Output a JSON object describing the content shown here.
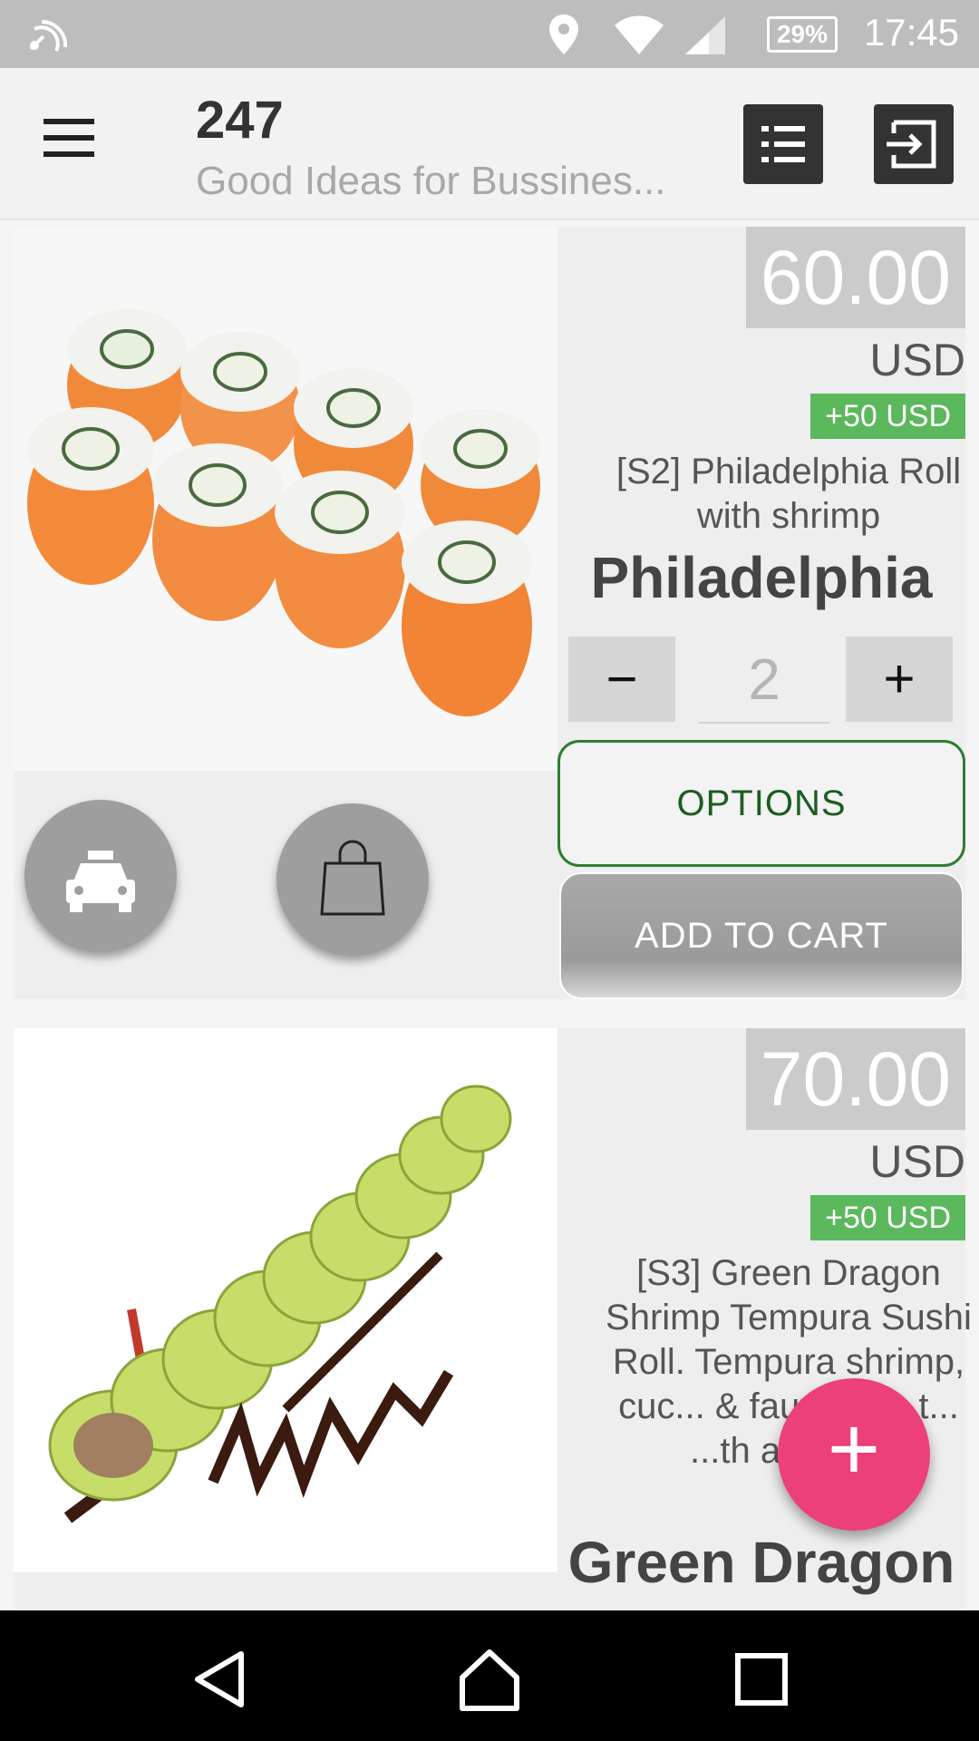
{
  "status_bar": {
    "time": "17:45",
    "battery": "29%",
    "icons": [
      "nfc-icon",
      "location-icon",
      "wifi-icon",
      "signal-icon",
      "battery-icon"
    ]
  },
  "app_bar": {
    "title": "247",
    "subtitle": "Good Ideas for Bussines...",
    "icons": [
      "menu-icon",
      "list-icon",
      "logout-icon"
    ]
  },
  "products": [
    {
      "price": "60.00",
      "currency": "USD",
      "extra": "+50 USD",
      "description": "[S2] Philadelphia Roll with shrimp",
      "name": "Philadelphia",
      "quantity": "2",
      "minus_label": "−",
      "plus_label": "+",
      "options_label": "OPTIONS",
      "add_to_cart_label": "ADD TO CART",
      "action_icons": [
        "taxi-icon",
        "shopping-bag-icon"
      ]
    },
    {
      "price": "70.00",
      "currency": "USD",
      "extra": "+50 USD",
      "description": "[S3] Green Dragon Shrimp Tempura Sushi Roll. Tempura shrimp, cuc... & faux crab, t... ...th avoca...",
      "name": "Green Dragon"
    }
  ],
  "fab": {
    "label": "+",
    "icon": "add-icon",
    "color": "#ec407a"
  },
  "nav_bar": {
    "icons": [
      "back-icon",
      "home-icon",
      "recents-icon"
    ]
  },
  "colors": {
    "accent_green": "#5cb85c",
    "options_border": "#2e7d32",
    "fab_pink": "#ec407a"
  }
}
